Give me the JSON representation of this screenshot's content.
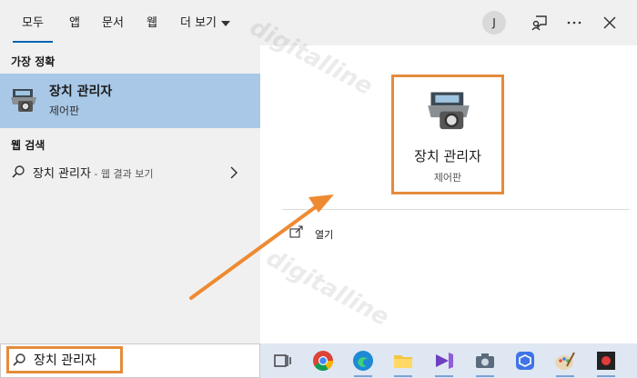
{
  "tabs": [
    {
      "label": "모두",
      "active": true
    },
    {
      "label": "앱"
    },
    {
      "label": "문서"
    },
    {
      "label": "웹"
    },
    {
      "label": "더 보기"
    }
  ],
  "user": {
    "initial": "J"
  },
  "best_match": {
    "heading": "가장 정확",
    "title": "장치 관리자",
    "subtitle": "제어판",
    "icon": "device-manager-icon"
  },
  "web_search": {
    "heading": "웹 검색",
    "query": "장치 관리자",
    "suffix": " - 웹 결과 보기"
  },
  "detail": {
    "title": "장치 관리자",
    "subtitle": "제어판",
    "open_label": "열기"
  },
  "search": {
    "value": "장치 관리자"
  },
  "watermark": "digitalline",
  "colors": {
    "accent": "#0063b1",
    "highlight": "#e58b3b",
    "selected_row": "#a9c8e8"
  }
}
